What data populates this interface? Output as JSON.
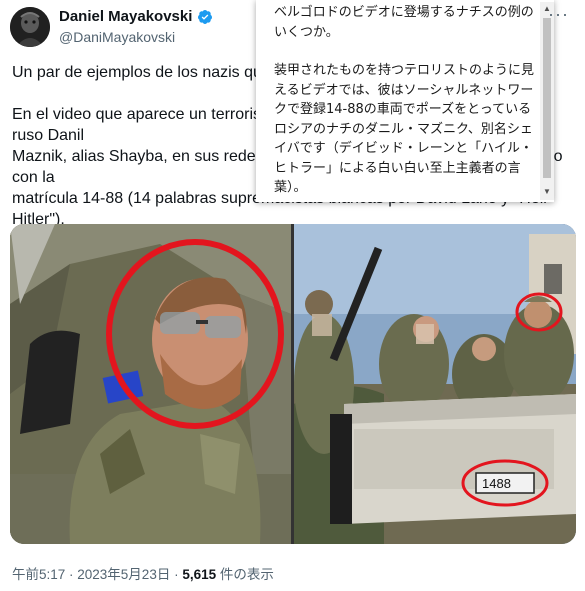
{
  "author": {
    "name": "Daniel Mayakovski",
    "handle": "@DaniMayakovski"
  },
  "tweet": {
    "paragraphs": [
      "Un par de ejemplos de los nazis que aparecen en el video de Belgorod.",
      "En el video que aparece un terrorista posando en un vehículo blindado es el ruso Danil\nMaznik, alias Shayba, en sus redes sociales aparece posando en un vehículo con la\nmatrícula 14-88 (14 palabras supremacistas blancas por David Lane y \"Heil\nHitler\")."
    ]
  },
  "translation_popup": {
    "paragraphs": [
      "ベルゴロドのビデオに登場するナチスの例のいくつか。",
      "装甲されたものを持つテロリストのように見えるビデオでは、彼はソーシャルネットワークで登録14-88の車両でポーズをとっているロシアのナチのダニル・マズニク、別名シェイバです（デイビッド・レーンと「ハイル・ヒトラー」による白い白い至上主義者の言葉）。"
    ]
  },
  "media": {
    "plate_text": "1488"
  },
  "footer": {
    "time_date": "午前5:17 · 2023年5月23日 · ",
    "views_count": "5,615",
    "views_label": " 件の表示"
  },
  "colors": {
    "text_primary": "#0f1419",
    "text_secondary": "#536471",
    "verified_blue": "#1d9bf0",
    "highlight_circle": "#e3151e"
  }
}
